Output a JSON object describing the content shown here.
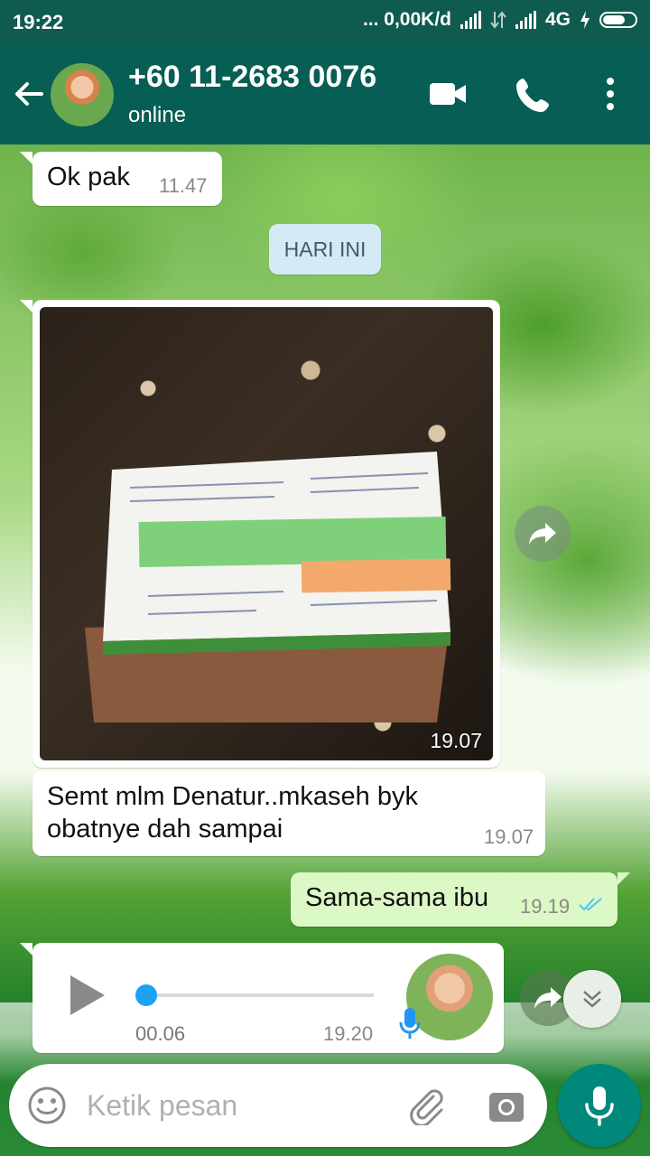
{
  "status_bar": {
    "time": "19:22",
    "network_speed": "... 0,00K/d",
    "network_type": "4G"
  },
  "header": {
    "contact_name": "+60 11-2683 0076",
    "contact_status": "online",
    "icons": [
      "back-arrow-icon",
      "video-call-icon",
      "phone-icon",
      "more-vert-icon"
    ]
  },
  "wallpaper": {
    "text": ""
  },
  "messages": [
    {
      "id": "m1",
      "direction": "incoming",
      "text": "Ok pak",
      "time": "11.47"
    },
    {
      "id": "divider",
      "type": "date",
      "text": "HARI INI"
    },
    {
      "id": "m2",
      "direction": "incoming",
      "type": "image",
      "time": "19.07"
    },
    {
      "id": "m3",
      "direction": "incoming",
      "text": "Semt mlm Denatur..mkaseh byk obatnye dah sampai",
      "time": "19.07"
    },
    {
      "id": "m4",
      "direction": "outgoing",
      "text": "Sama-sama ibu",
      "time": "19.19",
      "status": "read"
    },
    {
      "id": "m5",
      "direction": "incoming",
      "type": "voice",
      "duration": "00.06",
      "time": "19.20",
      "progress": 0
    }
  ],
  "composer": {
    "placeholder": "Ketik pesan",
    "icons": [
      "emoji-icon",
      "attach-icon",
      "camera-icon",
      "mic-icon"
    ]
  },
  "colors": {
    "header": "#075e54",
    "status_bar": "#0f5b4f",
    "outgoing_bubble": "#dcf8c6",
    "read_ticks": "#4fc3f7",
    "fab": "#00897b"
  }
}
